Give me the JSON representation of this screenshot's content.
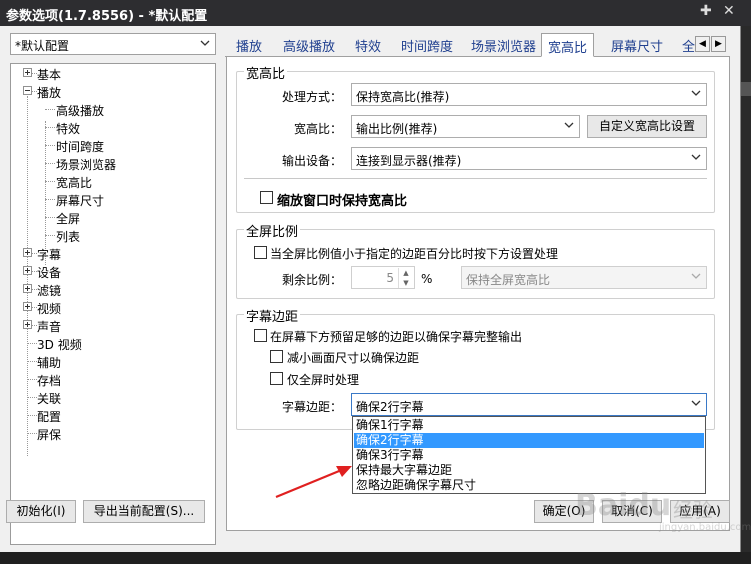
{
  "window": {
    "title": "参数选项(1.7.8556) - *默认配置",
    "pin_glyph": "✚",
    "close_glyph": "✕"
  },
  "profile_select": {
    "value": "*默认配置"
  },
  "tree": {
    "items": [
      {
        "label": "基本",
        "level": 0,
        "expander": "plus"
      },
      {
        "label": "播放",
        "level": 0,
        "expander": "minus"
      },
      {
        "label": "高级播放",
        "level": 1
      },
      {
        "label": "特效",
        "level": 1
      },
      {
        "label": "时间跨度",
        "level": 1
      },
      {
        "label": "场景浏览器",
        "level": 1
      },
      {
        "label": "宽高比",
        "level": 1
      },
      {
        "label": "屏幕尺寸",
        "level": 1
      },
      {
        "label": "全屏",
        "level": 1
      },
      {
        "label": "列表",
        "level": 1
      },
      {
        "label": "字幕",
        "level": 0,
        "expander": "plus"
      },
      {
        "label": "设备",
        "level": 0,
        "expander": "plus"
      },
      {
        "label": "滤镜",
        "level": 0,
        "expander": "plus"
      },
      {
        "label": "视频",
        "level": 0,
        "expander": "plus"
      },
      {
        "label": "声音",
        "level": 0,
        "expander": "plus"
      },
      {
        "label": "3D 视频",
        "level": 0
      },
      {
        "label": "辅助",
        "level": 0
      },
      {
        "label": "存档",
        "level": 0
      },
      {
        "label": "关联",
        "level": 0
      },
      {
        "label": "配置",
        "level": 0
      },
      {
        "label": "屏保",
        "level": 0
      }
    ]
  },
  "tabs": {
    "items": [
      "播放",
      "高级播放",
      "特效",
      "时间跨度",
      "场景浏览器",
      "宽高比",
      "屏幕尺寸",
      "全"
    ],
    "active_index": 5,
    "scroll_left": "◀",
    "scroll_right": "▶"
  },
  "aspect_group": {
    "title": "宽高比",
    "mode_label": "处理方式：",
    "mode_value": "保持宽高比(推荐)",
    "ratio_label": "宽高比：",
    "ratio_value": "输出比例(推荐)",
    "custom_button": "自定义宽高比设置",
    "output_label": "输出设备：",
    "output_value": "连接到显示器(推荐)",
    "keep_on_scale_label": "缩放窗口时保持宽高比"
  },
  "fullscreen_group": {
    "title": "全屏比例",
    "condition_label": "当全屏比例值小于指定的边距百分比时按下方设置处理",
    "remain_label": "剩余比例：",
    "remain_value": "5",
    "percent_sign": "%",
    "action_value": "保持全屏宽高比"
  },
  "subtitle_group": {
    "title": "字幕边距",
    "reserve_label": "在屏幕下方预留足够的边距以确保字幕完整输出",
    "shrink_label": "减小画面尺寸以确保边距",
    "fullscreen_only_label": "仅全屏时处理",
    "margin_label": "字幕边距：",
    "margin_value": "确保2行字幕",
    "options": [
      "确保1行字幕",
      "确保2行字幕",
      "确保3行字幕",
      "保持最大字幕边距",
      "忽略边距确保字幕尺寸"
    ],
    "selected_index": 1
  },
  "footer": {
    "init_button": "初始化(I)",
    "export_button": "导出当前配置(S)...",
    "ok_button": "确定(O)",
    "cancel_button": "取消(C)",
    "apply_button": "应用(A)"
  },
  "watermark": {
    "brand": "Baidu",
    "brand_cn": "经验",
    "site": "jingyan.baidu.com"
  },
  "colors": {
    "accent": "#3399ff",
    "arrow": "#e02020",
    "tab_text": "#1f3f8f"
  }
}
